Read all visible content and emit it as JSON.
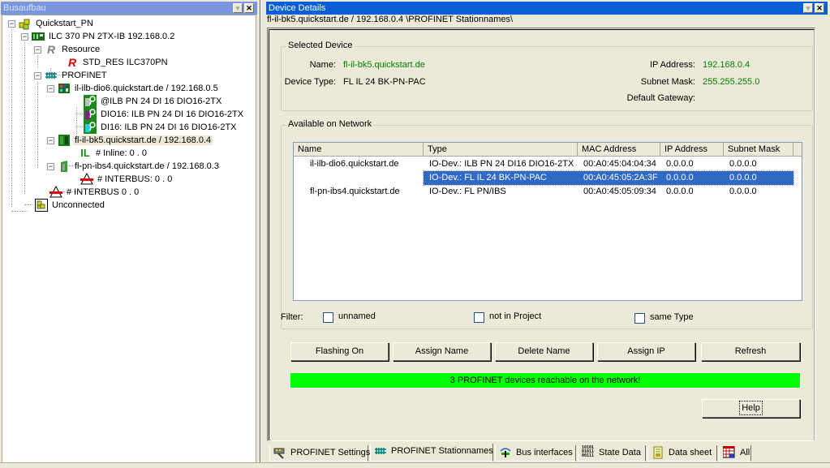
{
  "left_panel": {
    "title": "Busaufbau",
    "tree": [
      {
        "label": "Quickstart_PN",
        "icon": "project-icon"
      },
      {
        "label": "ILC 370 PN 2TX-IB 192.168.0.2",
        "icon": "controller-icon"
      },
      {
        "label": "Resource",
        "icon": "resource-icon"
      },
      {
        "label": "STD_RES ILC370PN",
        "icon": "std-resource-icon"
      },
      {
        "label": "PROFINET",
        "icon": "profinet-icon"
      },
      {
        "label": "il-ilb-dio6.quickstart.de / 192.168.0.5",
        "icon": "io-device-icon"
      },
      {
        "label": "@ILB PN 24 DI 16 DIO16-2TX",
        "icon": "module-icon"
      },
      {
        "label": "DIO16: ILB PN 24 DI 16 DIO16-2TX",
        "icon": "module-icon"
      },
      {
        "label": "DI16: ILB PN 24 DI 16 DIO16-2TX",
        "icon": "module-icon"
      },
      {
        "label": "fl-il-bk5.quickstart.de / 192.168.0.4",
        "icon": "bus-coupler-icon"
      },
      {
        "label": "# Inline: 0 . 0",
        "icon": "inline-icon"
      },
      {
        "label": "fl-pn-ibs4.quickstart.de / 192.168.0.3",
        "icon": "proxy-icon"
      },
      {
        "label": "# INTERBUS: 0 . 0",
        "icon": "interbus-icon"
      },
      {
        "label": "# INTERBUS 0 . 0",
        "icon": "interbus-icon"
      },
      {
        "label": "Unconnected",
        "icon": "unconnected-icon"
      }
    ]
  },
  "right_panel": {
    "title": "Device Details",
    "path": "fl-il-bk5.quickstart.de / 192.168.0.4 \\PROFINET Stationnames\\",
    "selected_device": {
      "group_title": "Selected Device",
      "name_label": "Name:",
      "name_value": "fl-il-bk5.quickstart.de",
      "type_label": "Device Type:",
      "type_value": "FL IL 24 BK-PN-PAC",
      "ip_label": "IP Address:",
      "ip_value": "192.168.0.4",
      "subnet_label": "Subnet Mask:",
      "subnet_value": "255.255.255.0",
      "gateway_label": "Default Gateway:",
      "gateway_value": ""
    },
    "network": {
      "group_title": "Available on Network",
      "columns": [
        "Name",
        "Type",
        "MAC Address",
        "IP Address",
        "Subnet Mask"
      ],
      "rows": [
        {
          "name": "il-ilb-dio6.quickstart.de",
          "type": "IO-Dev.: ILB PN 24 DI16 DIO16-2TX",
          "mac": "00:A0:45:04:04:34",
          "ip": "0.0.0.0",
          "subnet": "0.0.0.0",
          "selected": false
        },
        {
          "name": "",
          "type": "IO-Dev.: FL IL 24 BK-PN-PAC",
          "mac": "00:A0:45:05:2A:3F",
          "ip": "0.0.0.0",
          "subnet": "0.0.0.0",
          "selected": true
        },
        {
          "name": "fl-pn-ibs4.quickstart.de",
          "type": "IO-Dev.: FL PN/IBS",
          "mac": "00:A0:45:05:09:34",
          "ip": "0.0.0.0",
          "subnet": "0.0.0.0",
          "selected": false
        }
      ],
      "filter_label": "Filter:",
      "filters": [
        {
          "label": "unnamed",
          "checked": false
        },
        {
          "label": "not in Project",
          "checked": false
        },
        {
          "label": "same Type",
          "checked": false
        }
      ]
    },
    "buttons": {
      "flashing_on": "Flashing On",
      "assign_name": "Assign Name",
      "delete_name": "Delete Name",
      "assign_ip": "Assign IP",
      "refresh": "Refresh",
      "help": "Help"
    },
    "status_message": "3 PROFINET devices reachable on the network!",
    "status_color": "#00ff00",
    "tabs": [
      {
        "label": "PROFINET Settings",
        "icon": "network-card-icon",
        "active": false
      },
      {
        "label": "PROFINET Stationnames",
        "icon": "profinet-icon",
        "active": true
      },
      {
        "label": "Bus interfaces",
        "icon": "bus-interface-icon",
        "active": false
      },
      {
        "label": "State Data",
        "icon": "binary-data-icon",
        "active": false
      },
      {
        "label": "Data sheet",
        "icon": "datasheet-icon",
        "active": false
      },
      {
        "label": "All",
        "icon": "grid-icon",
        "active": false
      }
    ]
  },
  "colors": {
    "active_title": "#0a5fd8",
    "inactive_title": "#7a96df",
    "selection": "#316ac5",
    "value_green": "#008000"
  }
}
